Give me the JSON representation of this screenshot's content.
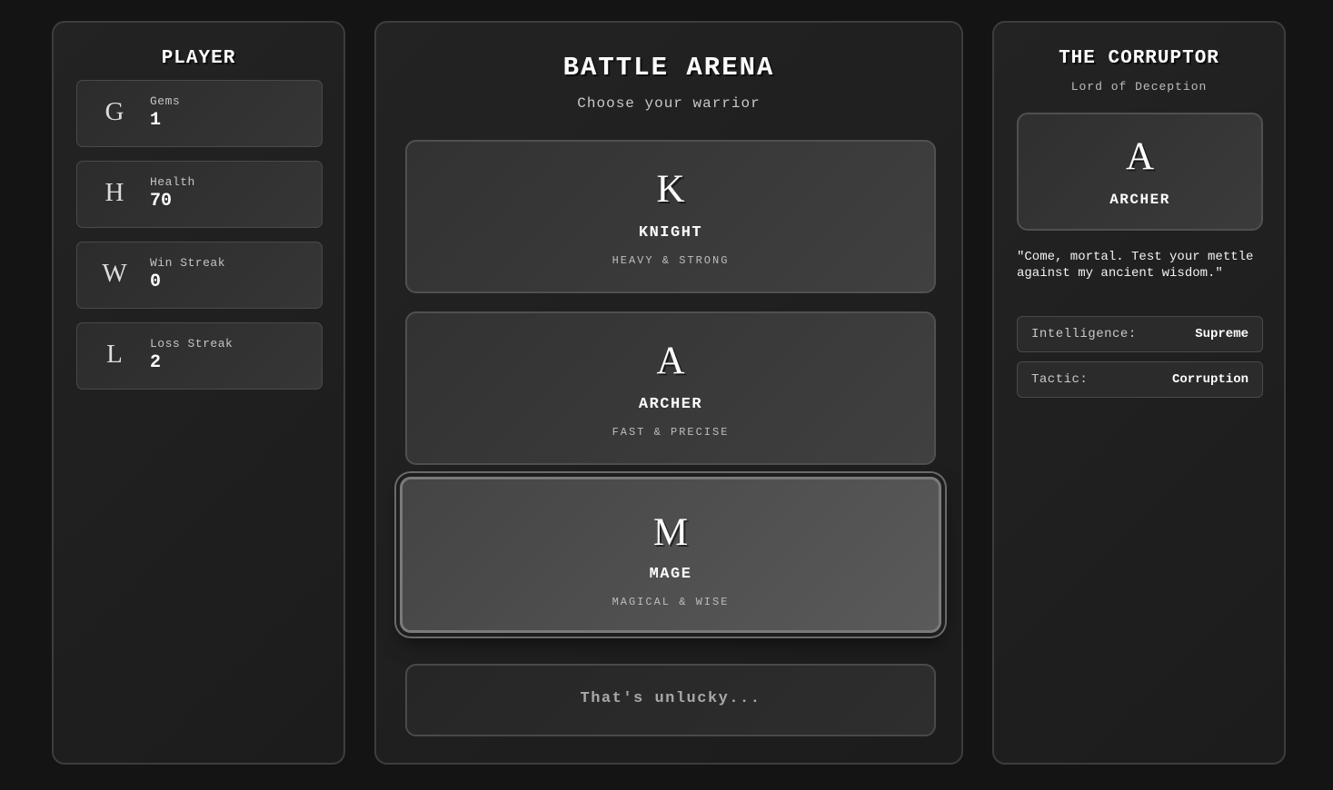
{
  "player": {
    "title": "PLAYER",
    "stats": [
      {
        "letter": "G",
        "label": "Gems",
        "value": "1"
      },
      {
        "letter": "H",
        "label": "Health",
        "value": "70"
      },
      {
        "letter": "W",
        "label": "Win Streak",
        "value": "0"
      },
      {
        "letter": "L",
        "label": "Loss Streak",
        "value": "2"
      }
    ]
  },
  "arena": {
    "title": "BATTLE ARENA",
    "subtitle": "Choose your warrior",
    "warriors": [
      {
        "letter": "K",
        "name": "KNIGHT",
        "desc": "HEAVY & STRONG"
      },
      {
        "letter": "A",
        "name": "ARCHER",
        "desc": "FAST & PRECISE"
      },
      {
        "letter": "M",
        "name": "MAGE",
        "desc": "MAGICAL & WISE"
      }
    ],
    "selected_warrior": "MAGE",
    "result": "That's unlucky..."
  },
  "enemy": {
    "title": "THE CORRUPTOR",
    "subtitle": "Lord of Deception",
    "card": {
      "letter": "A",
      "class": "ARCHER"
    },
    "quote": "\"Come, mortal. Test your mettle against my ancient wisdom.\"",
    "traits": [
      {
        "label": "Intelligence:",
        "value": "Supreme"
      },
      {
        "label": "Tactic:",
        "value": "Corruption"
      }
    ]
  },
  "colors": {
    "background": "#141414",
    "panel": "#1f1f1f",
    "border": "#3d3d3d",
    "selected_border": "#7a7a7a",
    "text": "#ffffff"
  }
}
